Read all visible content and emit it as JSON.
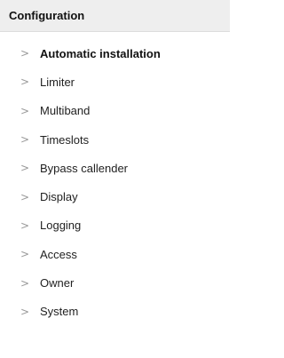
{
  "header": {
    "title": "Configuration"
  },
  "menu": {
    "items": [
      {
        "label": "Automatic installation",
        "icon": "chevron-right-icon",
        "glyph": ">",
        "active": true
      },
      {
        "label": "Limiter",
        "icon": "chevron-right-icon",
        "glyph": ">"
      },
      {
        "label": "Multiband",
        "icon": "chevron-right-icon",
        "glyph": ">"
      },
      {
        "label": "Timeslots",
        "icon": "chevron-right-icon",
        "glyph": ">"
      },
      {
        "label": "Bypass callender",
        "icon": "chevron-right-icon",
        "glyph": ">"
      },
      {
        "label": "Display",
        "icon": "chevron-right-icon",
        "glyph": ">"
      },
      {
        "label": "Logging",
        "icon": "chevron-right-icon",
        "glyph": ">"
      },
      {
        "label": "Access",
        "icon": "chevron-right-icon",
        "glyph": ">"
      },
      {
        "label": "Owner",
        "icon": "chevron-right-icon",
        "glyph": ">"
      },
      {
        "label": "System",
        "icon": "chevron-right-icon",
        "glyph": ">"
      }
    ]
  },
  "colors": {
    "header_bg": "#eeeeee",
    "chevron": "#999999",
    "text": "#222222"
  }
}
